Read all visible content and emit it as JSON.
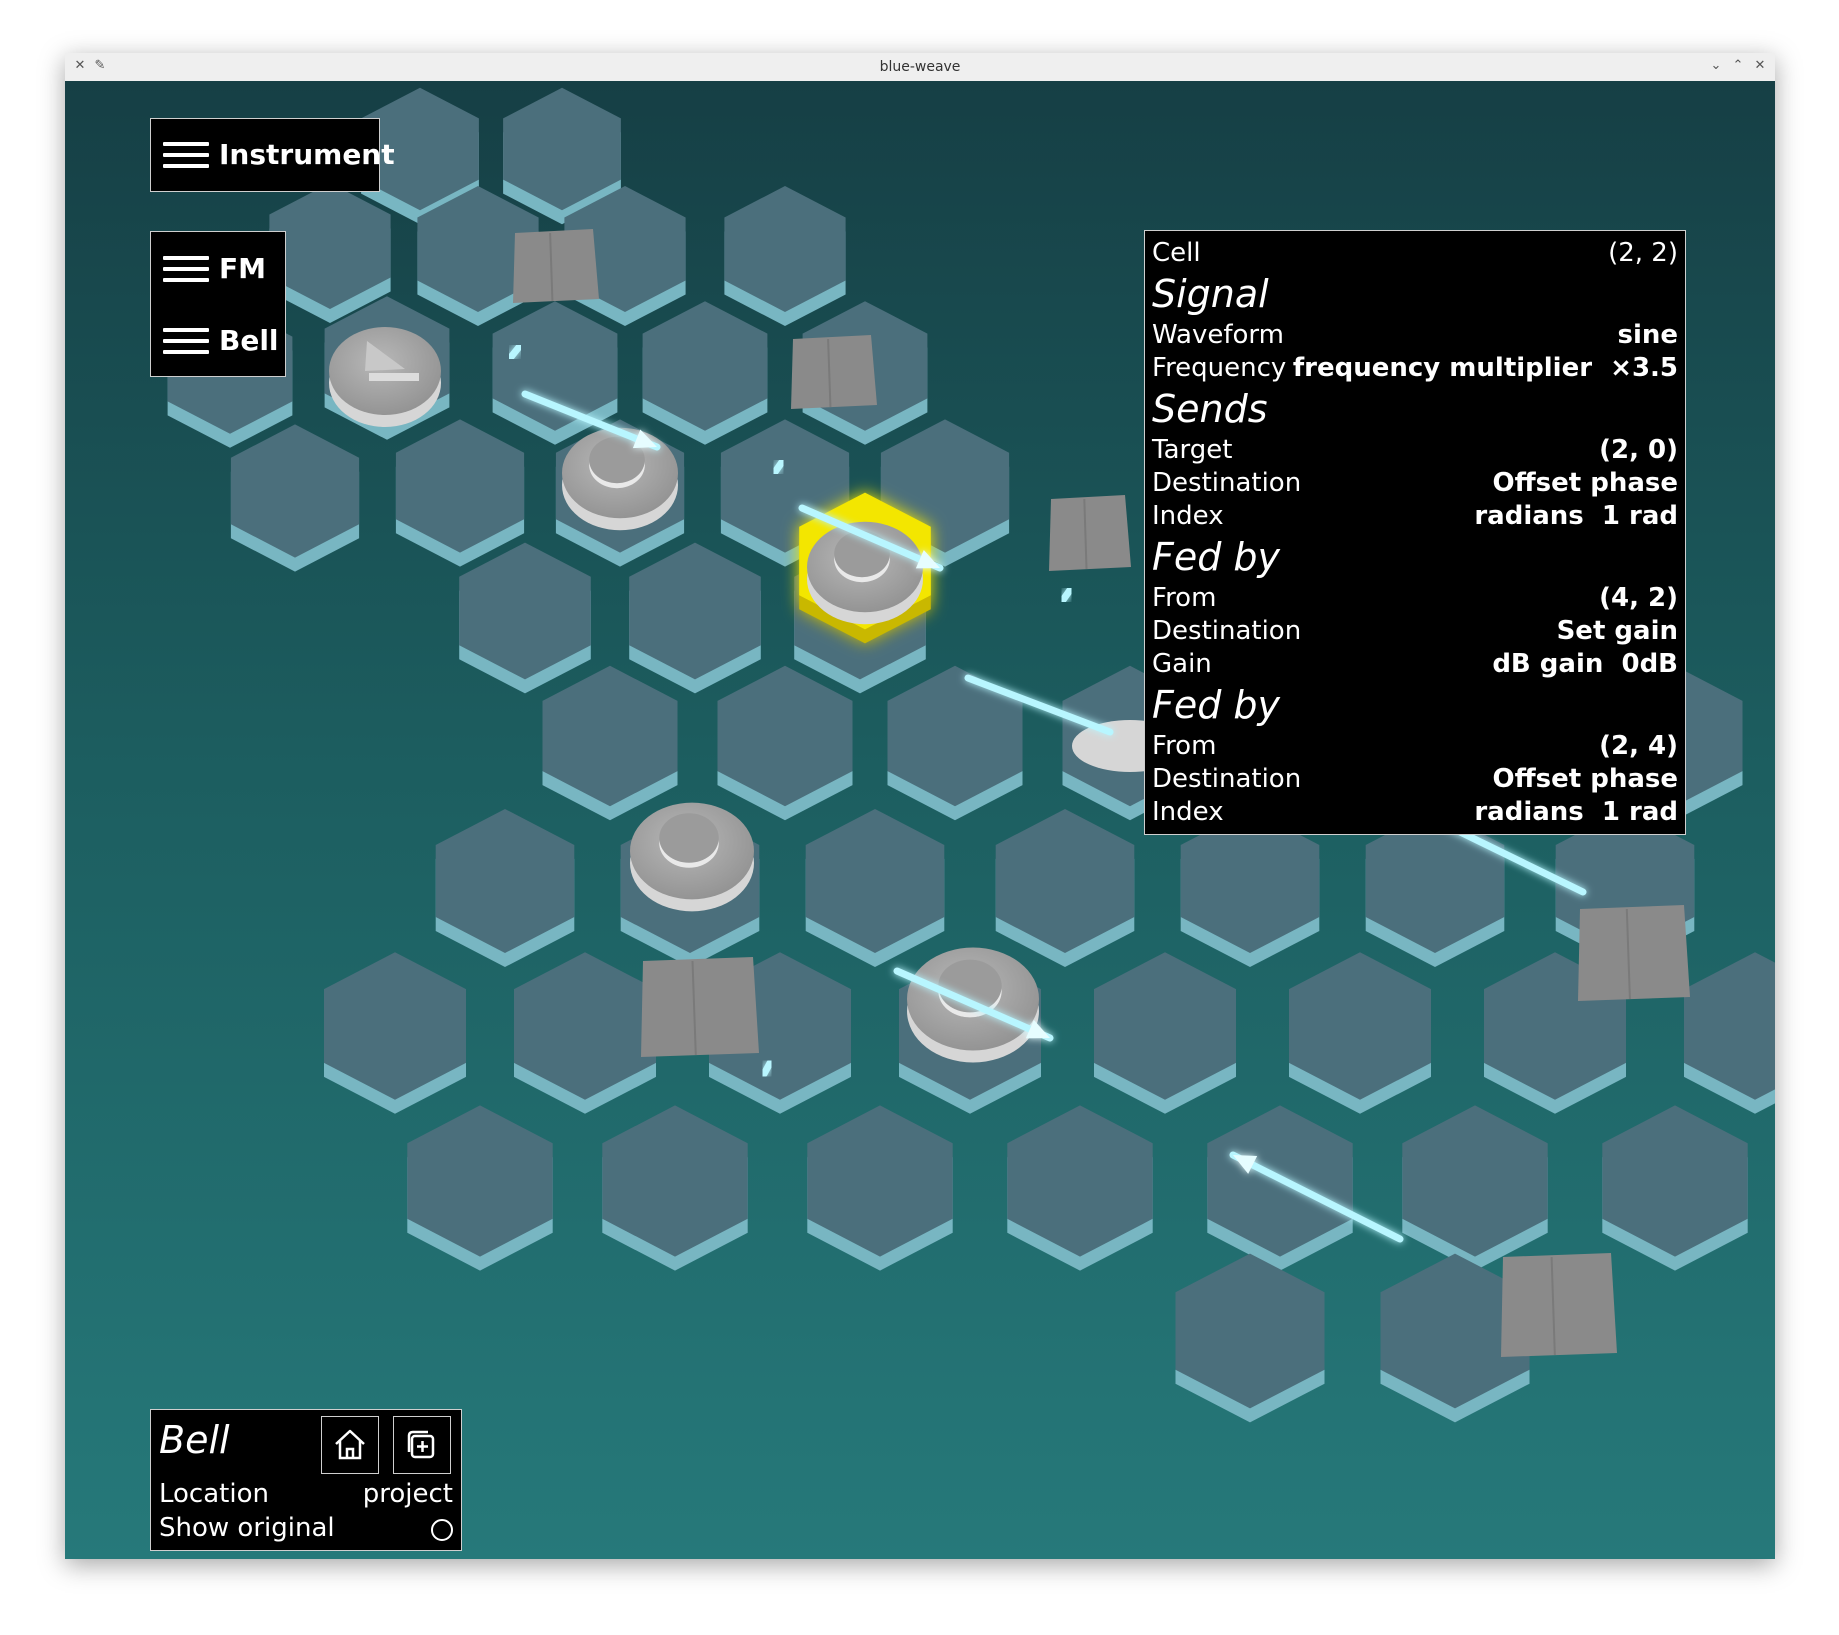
{
  "window": {
    "title": "blue-weave"
  },
  "menus": {
    "instrument": "Instrument",
    "category": "FM",
    "preset": "Bell"
  },
  "info": {
    "cell": {
      "label": "Cell",
      "value": "(2, 2)"
    },
    "signal": {
      "heading": "Signal",
      "waveform": {
        "label": "Waveform",
        "value": "sine"
      },
      "frequency": {
        "label": "Frequency",
        "value": "frequency multiplier  ×3.5"
      }
    },
    "sends": {
      "heading": "Sends",
      "target": {
        "label": "Target",
        "value": "(2, 0)"
      },
      "destination": {
        "label": "Destination",
        "value": "Offset phase"
      },
      "index": {
        "label": "Index",
        "value": "radians  1 rad"
      }
    },
    "fed_by": [
      {
        "heading": "Fed by",
        "from": {
          "label": "From",
          "value": "(4, 2)"
        },
        "destination": {
          "label": "Destination",
          "value": "Set gain"
        },
        "param": {
          "label": "Gain",
          "value": "dB gain  0dB"
        }
      },
      {
        "heading": "Fed by",
        "from": {
          "label": "From",
          "value": "(2, 4)"
        },
        "destination": {
          "label": "Destination",
          "value": "Offset phase"
        },
        "param": {
          "label": "Index",
          "value": "radians  1 rad"
        }
      }
    ]
  },
  "bottom": {
    "name": "Bell",
    "location_label": "Location",
    "location_value": "project",
    "show_original_label": "Show original",
    "show_original_checked": false
  },
  "icons": [
    "home-icon",
    "duplicate-icon",
    "hamburger-menu-icon",
    "x-app-icon",
    "pin-icon",
    "minimize-icon",
    "maximize-icon",
    "close-icon"
  ],
  "colors": {
    "selected_cell": "#f3e600",
    "connection": "#b8f6ff",
    "cell_top": "#4b6f7c",
    "cell_side": "#78b6c2"
  }
}
